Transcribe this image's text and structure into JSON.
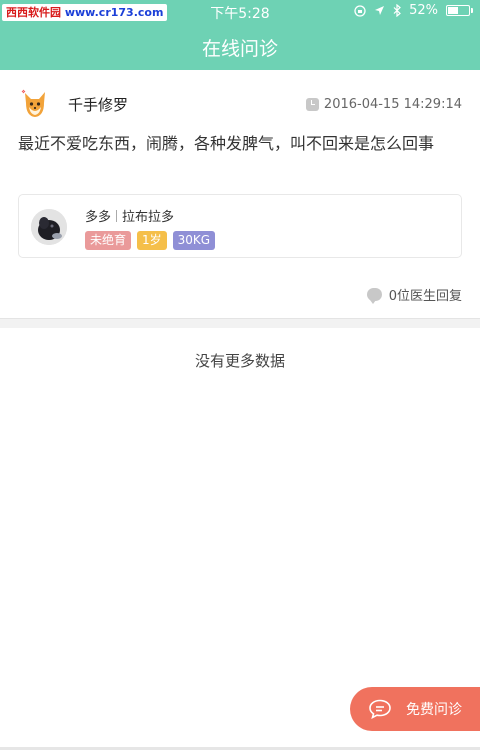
{
  "watermark": {
    "site": "西西软件园",
    "url": "www.cr173.com"
  },
  "status_bar": {
    "time": "下午5:28",
    "battery": "52%",
    "battery_level": 0.52
  },
  "nav": {
    "title": "在线问诊"
  },
  "question": {
    "username": "千手修罗",
    "timestamp": "2016-04-15 14:29:14",
    "text": "最近不爱吃东西，闹腾，各种发脾气，叫不回来是怎么回事"
  },
  "pet": {
    "name": "多多",
    "breed": "拉布拉多",
    "tags": [
      {
        "label": "未绝育",
        "color": "#ea9a9a"
      },
      {
        "label": "1岁",
        "color": "#f5bf4a"
      },
      {
        "label": "30KG",
        "color": "#8f8fd6"
      }
    ]
  },
  "replies": {
    "label": "0位医生回复"
  },
  "list_end": {
    "label": "没有更多数据"
  },
  "fab": {
    "label": "免费问诊"
  },
  "colors": {
    "header": "#6ed2b4",
    "fab": "#f0725e"
  }
}
